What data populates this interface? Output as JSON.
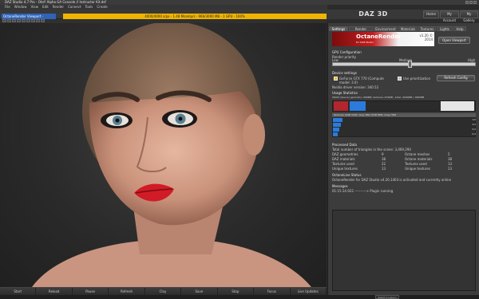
{
  "window": {
    "title": "DAZ Studio 4.7 Pro - OtoY Alpha GA Console // Instructor Kit.dsf"
  },
  "menu": [
    "File",
    "Window",
    "View",
    "Edit",
    "Render",
    "Connect",
    "Tools",
    "Create"
  ],
  "nav": {
    "logo": "DAZ 3D",
    "tabs": [
      "Home",
      "My Account",
      "My Gallery"
    ]
  },
  "viewport": {
    "title": "OctaneRender Viewport - Rendering (1920 x 1080) - 01:22:28/01:23:20",
    "status": "4000/4000 s/px - 1.48 Msamp/s - 966/3000 MB - 1 GPU - 100%",
    "footer_buttons": [
      "Start",
      "Reload",
      "Pause",
      "Refresh",
      "Clay",
      "Save",
      "Stop",
      "Focus",
      "Live Updates"
    ]
  },
  "panel": {
    "tabs": [
      "Settings",
      "Render Settings",
      "Environment",
      "Materials",
      "Textures",
      "Lights",
      "Help"
    ],
    "product": "OctaneRender",
    "product_sub": "for DAZ Studio",
    "version": "v1.20 © 2014",
    "open_viewport": "Open Viewport",
    "gpu_config_title": "GPU Configuration",
    "render_priority": "Render priority",
    "priority_low": "Low",
    "priority_medium": "Medium",
    "priority_high": "High",
    "device_settings": "Device settings",
    "device_name": "GeForce GTX 770 (Compute model: 3.0)",
    "peer_to_peer": "Use prioritization",
    "refresh_config": "Refresh Config",
    "nvidia_driver": "Nvidia driver version: 340.52",
    "usage_title": "Usage Statistics",
    "usage_line": "VRAM (device) geometry: 966MB, textures: 679MB - total: 4000MB / 1680MB",
    "textures_header": "Textures: RGB 32bit, Gray 8bit, RGB HDR, Gray HDR",
    "texture_counts": [
      "1/6",
      "3/4",
      "0/4",
      "0/4"
    ],
    "processed_title": "Processed Data",
    "triangles": "Total number of triangles in the scene: 3,469,290",
    "stats": [
      {
        "label": "DAZ geometries",
        "value": "9",
        "label2": "Octane meshes",
        "value2": "5"
      },
      {
        "label": "DAZ materials",
        "value": "38",
        "label2": "Octane materials",
        "value2": "38"
      },
      {
        "label": "Textures used",
        "value": "22",
        "label2": "Textures used",
        "value2": "13"
      },
      {
        "label": "Unique textures",
        "value": "13",
        "label2": "Unique textures",
        "value2": "13"
      }
    ],
    "activation_title": "OctaneLive Status",
    "activation_text": "OctaneRender for DAZ Studio v4.20.1403 is activated and currently online",
    "messages_title": "Messages",
    "messages": [
      "01:15:14.922 ----------> Plugin running"
    ]
  },
  "statusbar": {
    "selector": "Select a Lesson"
  },
  "colors": {
    "accent": "#f0b400",
    "viewport_title": "#2f63b8",
    "mem_red": "#b3262e",
    "mem_blue": "#2a7bdc"
  }
}
